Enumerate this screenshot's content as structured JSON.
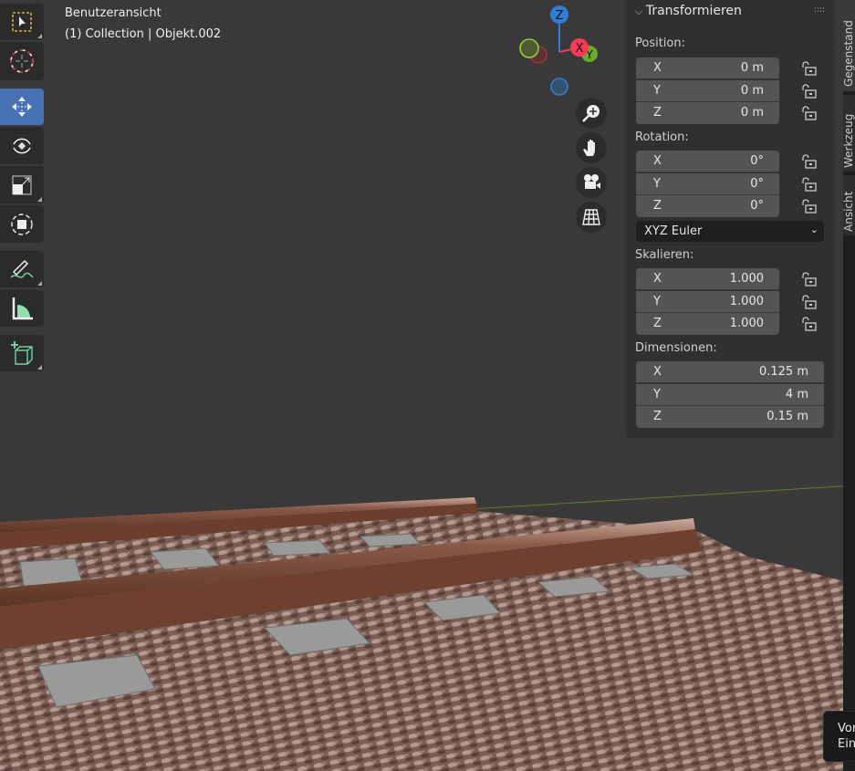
{
  "viewport": {
    "view_name": "Benutzeransicht",
    "collection_info": "(1) Collection | Objekt.002"
  },
  "toolbar": [
    {
      "name": "select-box"
    },
    {
      "name": "cursor"
    },
    {
      "name": "move",
      "active": true
    },
    {
      "name": "rotate"
    },
    {
      "name": "scale"
    },
    {
      "name": "transform"
    },
    {
      "name": "annotate"
    },
    {
      "name": "measure"
    },
    {
      "name": "add-cube"
    }
  ],
  "gizmo": {
    "axes": {
      "z": "Z",
      "x": "X",
      "y": "Y"
    },
    "colors": {
      "x": "#f53b57",
      "y": "#6ca82c",
      "z": "#2f7fd8"
    },
    "buttons": [
      "zoom-icon",
      "hand-icon",
      "camera-icon",
      "grid-icon"
    ]
  },
  "panel": {
    "title": "Transformieren",
    "position": {
      "label": "Position:",
      "rows": [
        {
          "axis": "X",
          "value": "0 m"
        },
        {
          "axis": "Y",
          "value": "0 m"
        },
        {
          "axis": "Z",
          "value": "0 m"
        }
      ]
    },
    "rotation": {
      "label": "Rotation:",
      "rows": [
        {
          "axis": "X",
          "value": "0°"
        },
        {
          "axis": "Y",
          "value": "0°"
        },
        {
          "axis": "Z",
          "value": "0°"
        }
      ]
    },
    "rotation_mode": "XYZ Euler",
    "scale": {
      "label": "Skalieren:",
      "rows": [
        {
          "axis": "X",
          "value": "1.000"
        },
        {
          "axis": "Y",
          "value": "1.000"
        },
        {
          "axis": "Z",
          "value": "1.000"
        }
      ]
    },
    "dimensions": {
      "label": "Dimensionen:",
      "rows": [
        {
          "axis": "X",
          "value": "0.125 m"
        },
        {
          "axis": "Y",
          "value": "4 m"
        },
        {
          "axis": "Z",
          "value": "0.15 m"
        }
      ]
    }
  },
  "tabs": [
    "Gegenstand",
    "Werkzeug",
    "Ansicht"
  ],
  "tooltip": {
    "line1": "Vor",
    "line2": "Ein"
  }
}
